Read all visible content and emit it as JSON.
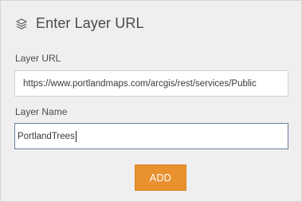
{
  "dialog": {
    "title": "Enter Layer URL",
    "icon": "layers-icon"
  },
  "layer_url": {
    "label": "Layer URL",
    "value": "https://www.portlandmaps.com/arcgis/rest/services/Public"
  },
  "layer_name": {
    "label": "Layer Name",
    "value": "PortlandTrees"
  },
  "add_button": {
    "label": "ADD",
    "color": "#e9902f"
  }
}
